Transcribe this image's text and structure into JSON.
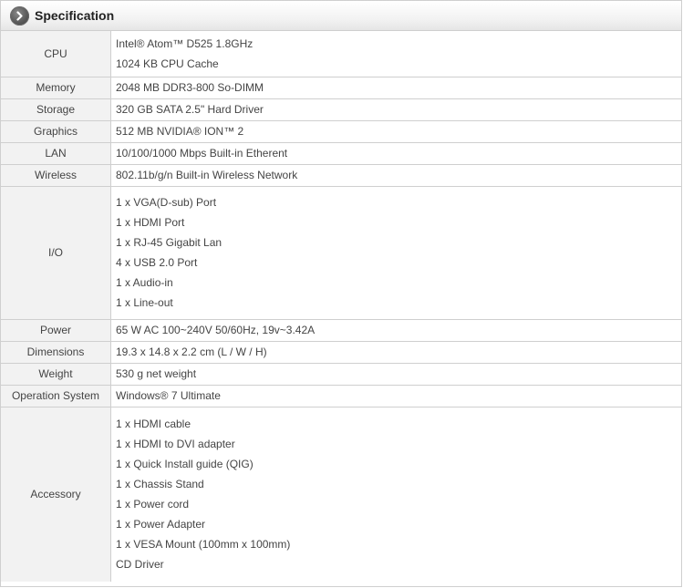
{
  "header": {
    "title": "Specification",
    "icon": "chevron-right-icon"
  },
  "rows": [
    {
      "label": "CPU",
      "values": [
        "Intel® Atom™ D525 1.8GHz",
        "1024 KB CPU Cache"
      ]
    },
    {
      "label": "Memory",
      "values": [
        "2048 MB DDR3-800 So-DIMM"
      ]
    },
    {
      "label": "Storage",
      "values": [
        "320 GB SATA 2.5\" Hard Driver"
      ]
    },
    {
      "label": "Graphics",
      "values": [
        "512 MB NVIDIA® ION™ 2"
      ]
    },
    {
      "label": "LAN",
      "values": [
        "10/100/1000 Mbps Built-in Etherent"
      ]
    },
    {
      "label": "Wireless",
      "values": [
        "802.11b/g/n Built-in Wireless Network"
      ]
    },
    {
      "label": "I/O",
      "values": [
        "1 x VGA(D-sub) Port",
        "1 x HDMI Port",
        "1 x RJ-45 Gigabit Lan",
        "4 x USB 2.0 Port",
        "1 x Audio-in",
        "1 x Line-out"
      ]
    },
    {
      "label": "Power",
      "values": [
        "65 W AC 100~240V 50/60Hz, 19v~3.42A"
      ]
    },
    {
      "label": "Dimensions",
      "values": [
        "19.3 x 14.8 x 2.2 cm (L / W / H)"
      ]
    },
    {
      "label": "Weight",
      "values": [
        "530 g net weight"
      ]
    },
    {
      "label": "Operation System",
      "values": [
        "Windows® 7 Ultimate"
      ]
    },
    {
      "label": "Accessory",
      "values": [
        "1 x HDMI cable",
        "1 x HDMI to DVI adapter",
        "1 x Quick Install guide (QIG)",
        "1 x Chassis Stand",
        "1 x Power cord",
        "1 x Power Adapter",
        "1 x VESA Mount (100mm x 100mm)",
        "CD Driver"
      ]
    }
  ]
}
